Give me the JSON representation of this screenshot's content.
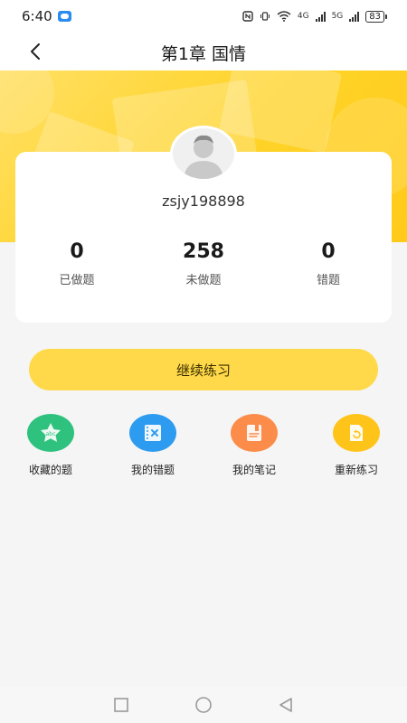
{
  "status_bar": {
    "time": "6:40",
    "network_1": "4G",
    "network_2": "5G",
    "battery": "83"
  },
  "header": {
    "title": "第1章 国情",
    "back_icon": "chevron-left-icon"
  },
  "profile": {
    "username": "zsjy198898",
    "avatar_icon": "default-user-avatar-icon"
  },
  "stats": [
    {
      "value": "0",
      "label": "已做题"
    },
    {
      "value": "258",
      "label": "未做题"
    },
    {
      "value": "0",
      "label": "错题"
    }
  ],
  "continue_button": {
    "label": "继续练习"
  },
  "actions": [
    {
      "label": "收藏的题",
      "icon": "star-icon",
      "color": "#2ec27e"
    },
    {
      "label": "我的错题",
      "icon": "wrong-book-icon",
      "color": "#2d9bf0"
    },
    {
      "label": "我的笔记",
      "icon": "notebook-icon",
      "color": "#fb8c4a"
    },
    {
      "label": "重新练习",
      "icon": "refresh-doc-icon",
      "color": "#ffc41a"
    }
  ],
  "colors": {
    "accent": "#ffd94a",
    "hero": "#ffd42a",
    "background": "#f5f5f5"
  },
  "nav": {
    "recent_icon": "square-recent-icon",
    "home_icon": "circle-home-icon",
    "back_icon": "triangle-back-icon"
  }
}
